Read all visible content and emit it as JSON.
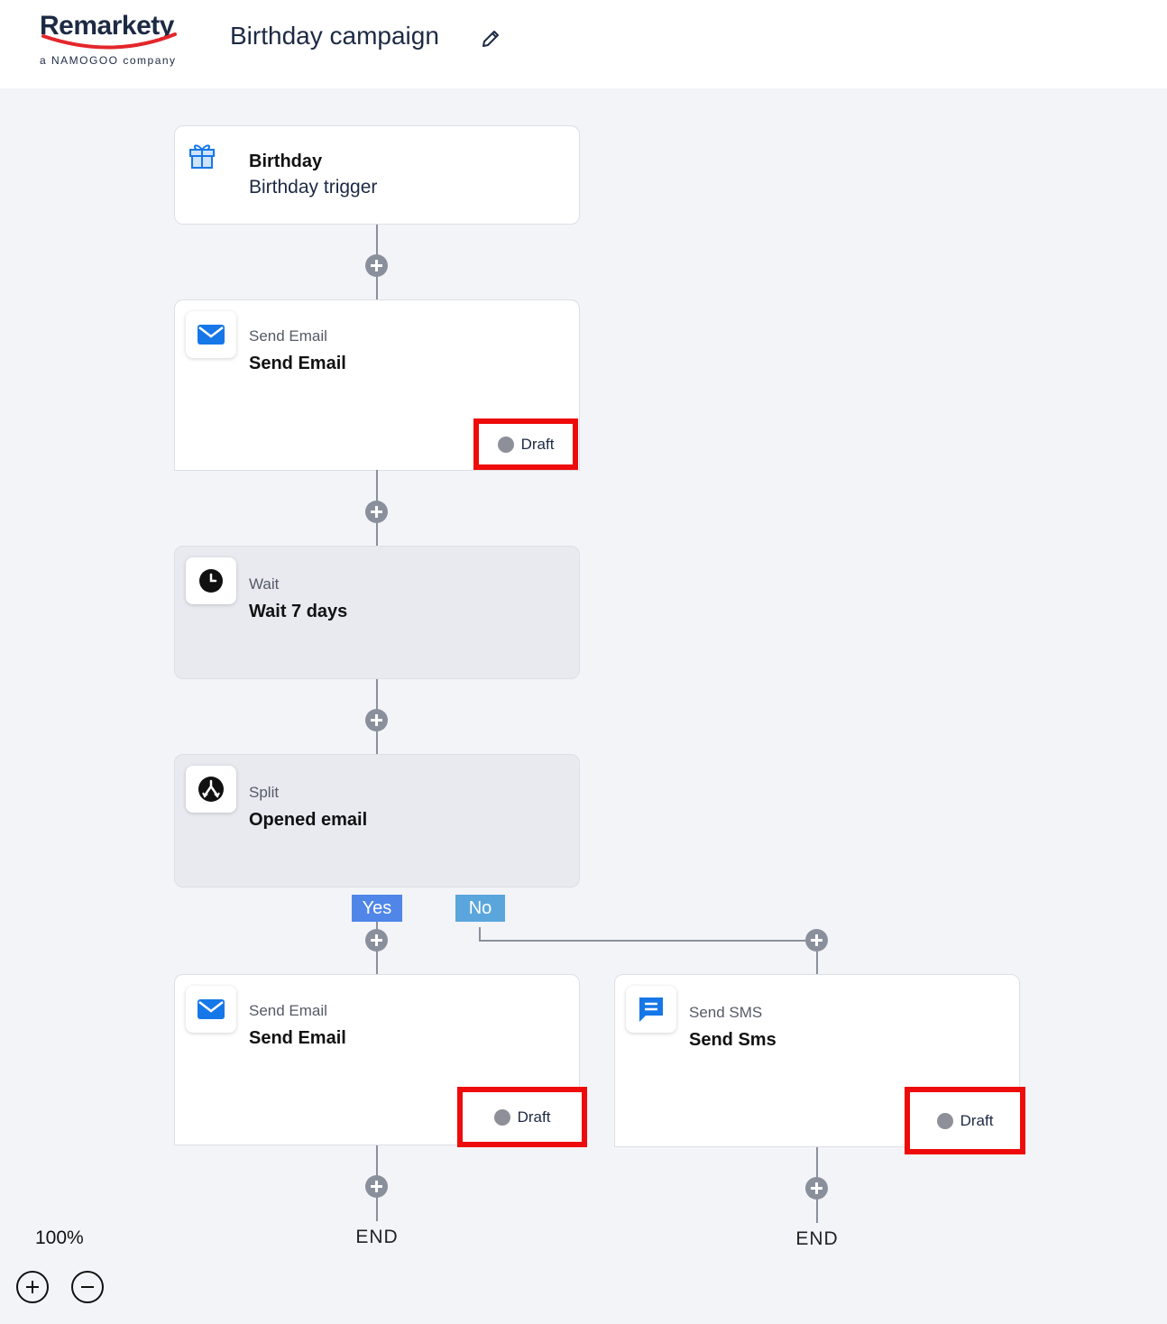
{
  "header": {
    "logo_text": "Remarkety",
    "logo_sub": "a NAMOGOO company",
    "title": "Birthday campaign"
  },
  "colors": {
    "accent_red": "#ee0b0b",
    "icon_blue": "#1677e8",
    "yes_branch": "#4f86e8",
    "no_branch": "#5aa6dc",
    "connector": "#8a8f9c"
  },
  "nodes": {
    "trigger": {
      "title": "Birthday",
      "subtitle": "Birthday trigger",
      "icon": "gift-icon"
    },
    "email1": {
      "type": "Send Email",
      "name": "Send Email",
      "status": "Draft",
      "icon": "envelope-icon"
    },
    "wait": {
      "type": "Wait",
      "name": "Wait 7 days",
      "icon": "clock-icon"
    },
    "split": {
      "type": "Split",
      "name": "Opened email",
      "icon": "split-icon"
    },
    "email2": {
      "type": "Send Email",
      "name": "Send Email",
      "status": "Draft",
      "icon": "envelope-icon"
    },
    "sms": {
      "type": "Send SMS",
      "name": "Send Sms",
      "status": "Draft",
      "icon": "chat-bubble-icon"
    }
  },
  "branches": {
    "yes": "Yes",
    "no": "No"
  },
  "end": {
    "left": "END",
    "right": "END"
  },
  "zoom": {
    "level": "100%"
  }
}
